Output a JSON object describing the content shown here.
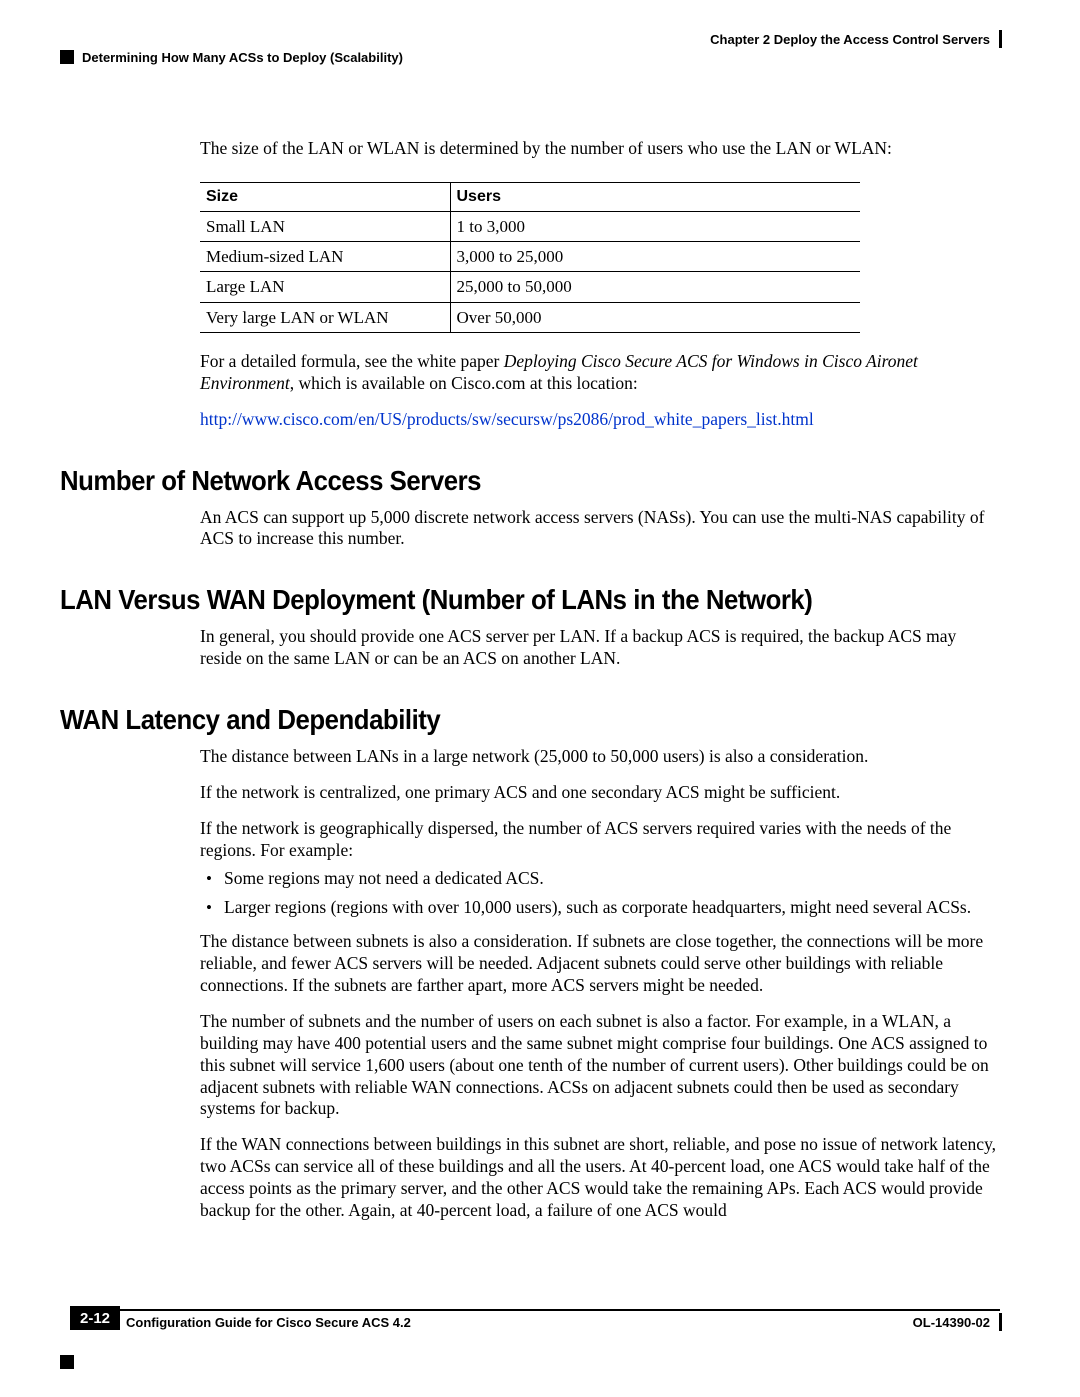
{
  "header": {
    "chapter": "Chapter 2      Deploy the Access Control Servers",
    "breadcrumb": "Determining How Many ACSs to Deploy (Scalability)"
  },
  "intro_para": "The size of the LAN or WLAN is determined by the number of users who use the LAN or WLAN:",
  "table": {
    "head": {
      "size": "Size",
      "users": "Users"
    },
    "rows": [
      {
        "size": "Small LAN",
        "users": "1 to 3,000"
      },
      {
        "size": "Medium-sized LAN",
        "users": "3,000 to 25,000"
      },
      {
        "size": "Large LAN",
        "users": "25,000 to 50,000"
      },
      {
        "size": "Very large LAN or WLAN",
        "users": "Over 50,000"
      }
    ]
  },
  "formula_para_pre": "For a detailed formula, see the white paper ",
  "formula_para_italic": "Deploying Cisco Secure ACS for Windows in Cisco Aironet Environment",
  "formula_para_post": ", which is available on Cisco.com at this location:",
  "link_text": "http://www.cisco.com/en/US/products/sw/secursw/ps2086/prod_white_papers_list.html",
  "sections": {
    "nas": {
      "heading": "Number of Network Access Servers",
      "para": "An ACS can support up 5,000 discrete network access servers (NASs). You can use the multi-NAS capability of ACS to increase this number."
    },
    "lan_wan": {
      "heading": "LAN Versus WAN Deployment (Number of LANs in the Network)",
      "para": "In general, you should provide one ACS server per LAN. If a backup ACS is required, the backup ACS may reside on the same LAN or can be an ACS on another LAN."
    },
    "wan_lat": {
      "heading": "WAN Latency and Dependability",
      "p1": "The distance between LANs in a large network (25,000 to 50,000 users) is also a consideration.",
      "p2": "If the network is centralized, one primary ACS and one secondary ACS might be sufficient.",
      "p3": "If the network is geographically dispersed, the number of ACS servers required varies with the needs of the regions. For example:",
      "bullets": [
        "Some regions may not need a dedicated ACS.",
        "Larger regions (regions with over 10,000 users), such as corporate headquarters, might need several ACSs."
      ],
      "p4": "The distance between subnets is also a consideration. If subnets are close together, the connections will be more reliable, and fewer ACS servers will be needed. Adjacent subnets could serve other buildings with reliable connections. If the subnets are farther apart, more ACS servers might be needed.",
      "p5": "The number of subnets and the number of users on each subnet is also a factor. For example, in a WLAN, a building may have 400 potential users and the same subnet might comprise four buildings. One ACS assigned to this subnet will service 1,600 users (about one tenth of the number of current users). Other buildings could be on adjacent subnets with reliable WAN connections. ACSs on adjacent subnets could then be used as secondary systems for backup.",
      "p6": "If the WAN connections between buildings in this subnet are short, reliable, and pose no issue of network latency, two ACSs can service all of these buildings and all the users. At 40-percent load, one ACS would take half of the access points as the primary server, and the other ACS would take the remaining APs. Each ACS would provide backup for the other. Again, at 40-percent load, a failure of one ACS would"
    }
  },
  "footer": {
    "guide": "Configuration Guide for Cisco Secure ACS 4.2",
    "page": "2-12",
    "doc_id": "OL-14390-02"
  }
}
